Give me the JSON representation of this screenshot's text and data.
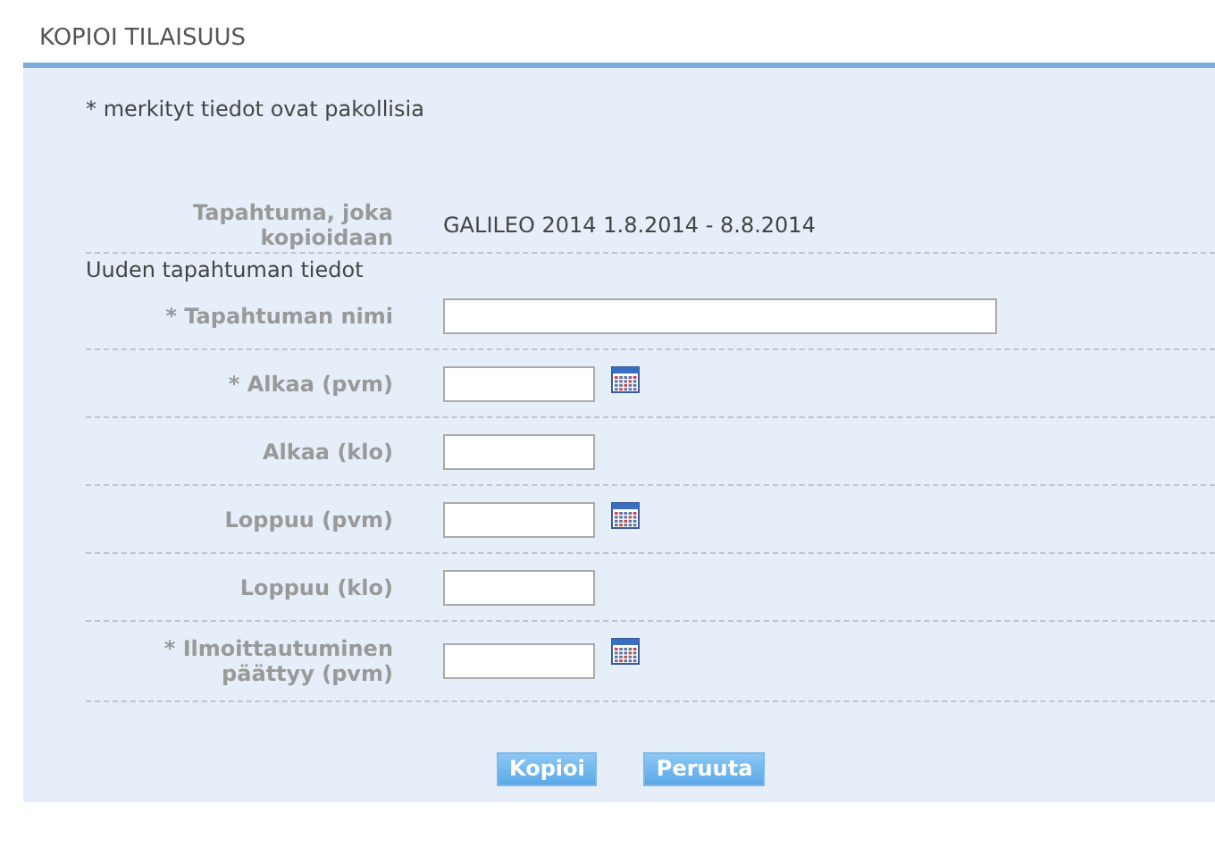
{
  "title": "KOPIOI TILAISUUS",
  "note": "* merkityt tiedot ovat pakollisia",
  "source": {
    "label": "Tapahtuma, joka kopioidaan",
    "value": "GALILEO 2014 1.8.2014 - 8.8.2014"
  },
  "section": "Uuden tapahtuman tiedot",
  "fields": [
    {
      "kind": "text",
      "label": "* Tapahtuman nimi"
    },
    {
      "kind": "date",
      "label": "* Alkaa (pvm)"
    },
    {
      "kind": "time",
      "label": "Alkaa (klo)"
    },
    {
      "kind": "date",
      "label": "Loppuu (pvm)"
    },
    {
      "kind": "time",
      "label": "Loppuu (klo)"
    },
    {
      "kind": "date",
      "label": "* Ilmoittautuminen päättyy (pvm)"
    }
  ],
  "buttons": [
    "Kopioi",
    "Peruuta"
  ]
}
